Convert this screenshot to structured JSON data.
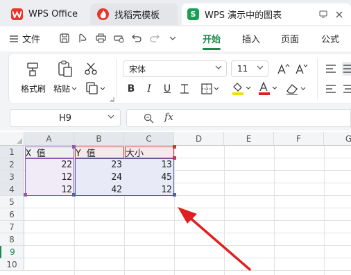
{
  "tabs": [
    {
      "label": "WPS Office",
      "icon": "wps-logo-icon"
    },
    {
      "label": "找稻壳模板",
      "icon": "docer-logo-icon"
    },
    {
      "label": "WPS 演示中的图表",
      "icon": "sheet-app-icon",
      "icon_text": "S"
    }
  ],
  "menu": {
    "file": "文件",
    "tabs": [
      "开始",
      "插入",
      "页面",
      "公式"
    ],
    "active": "开始"
  },
  "ribbon": {
    "format_painter": "格式刷",
    "paste": "粘贴",
    "font_name": "宋体",
    "font_size": "11"
  },
  "formula_bar": {
    "cell_ref": "H9",
    "fx": "fx",
    "content": ""
  },
  "sheet": {
    "columns": [
      "A",
      "B",
      "C",
      "D",
      "E",
      "F",
      "G"
    ],
    "rows": [
      "1",
      "2",
      "3",
      "4",
      "5",
      "6",
      "7",
      "8",
      "9",
      "10"
    ],
    "active_row": "9",
    "headers": [
      "X 值",
      "Y 值",
      "大小"
    ],
    "data": [
      [
        "22",
        "23",
        "13"
      ],
      [
        "12",
        "24",
        "45"
      ],
      [
        "12",
        "42",
        "12"
      ]
    ]
  },
  "colors": {
    "accent": "#1a8a4a",
    "wps_red": "#e8352b",
    "arrow": "#e02020",
    "range_x": "#8e5bb5",
    "range_y": "#4a63b5",
    "range_size": "#c23c3c",
    "highlight_yellow": "#f2e000",
    "font_red": "#e02020"
  }
}
